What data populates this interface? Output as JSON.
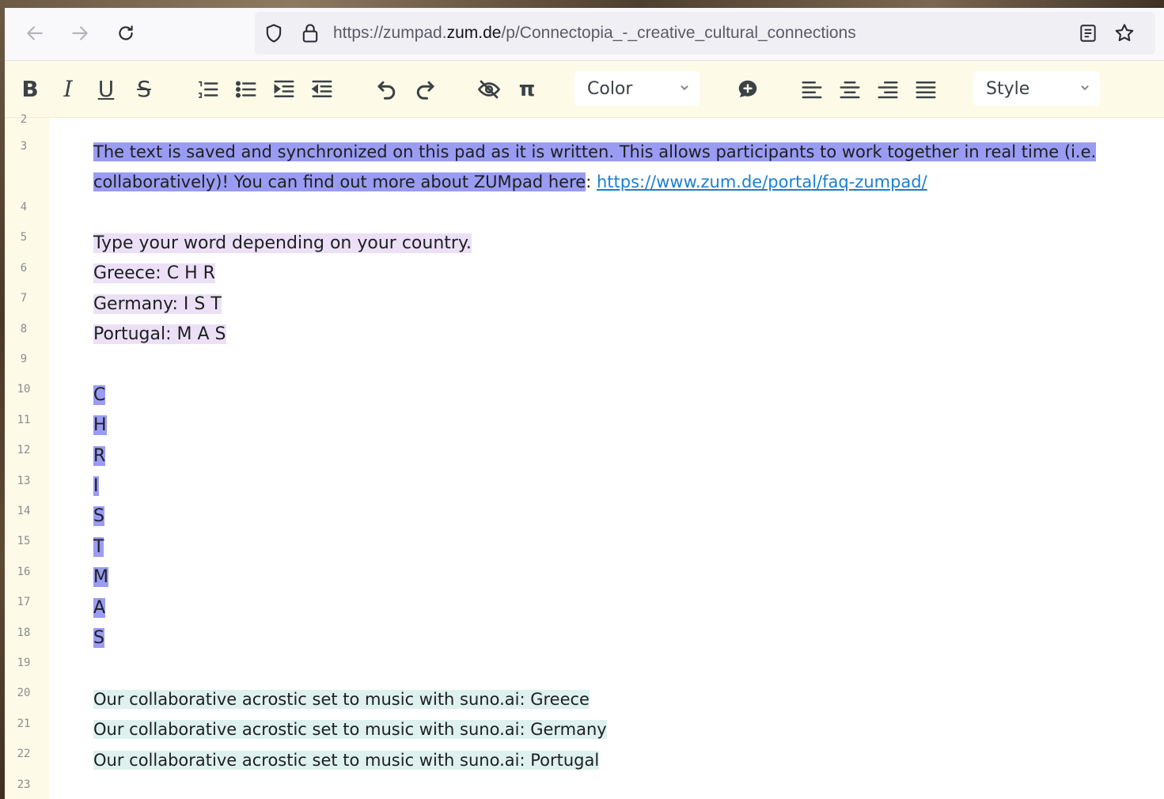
{
  "browser": {
    "url_prefix": "https://zumpad.",
    "url_domain": "zum.de",
    "url_path": "/p/Connectopia_-_creative_cultural_connections"
  },
  "toolbar": {
    "bold_label": "B",
    "italic_label": "I",
    "underline_label": "U",
    "strike_label": "S",
    "pi_label": "π",
    "color_label": "Color",
    "style_label": "Style"
  },
  "editor": {
    "line_numbers": [
      "2",
      "3",
      "4",
      "5",
      "6",
      "7",
      "8",
      "9",
      "10",
      "11",
      "12",
      "13",
      "14",
      "15",
      "16",
      "17",
      "18",
      "19",
      "20",
      "21",
      "22",
      "23"
    ],
    "intro_line1": "The text is saved and synchronized on this pad as it is written. This allows participants to work together in real time (i.e.",
    "intro_line2": "collaboratively)! You can find out more about ZUMpad here",
    "intro_colon": ": ",
    "intro_link": "https://www.zum.de/portal/faq-zumpad/",
    "instruction": "Type your word depending on your country.",
    "greece": "Greece: C H R",
    "germany": "Germany: I S T",
    "portugal": "Portugal:  M A S",
    "acrostic": [
      "C",
      "H",
      "R",
      "I",
      "S",
      "T",
      "M",
      "A",
      "S"
    ],
    "song_greece": "Our collaborative acrostic set to music with suno.ai: Greece",
    "song_germany": "Our collaborative acrostic set to music with suno.ai: Germany",
    "song_portugal": "Our collaborative acrostic set to music with suno.ai: Portugal"
  },
  "colors": {
    "author_blue": "#9a9cf3",
    "author_lilac": "#ece0f6",
    "author_mint": "#dff1ef",
    "toolbar_bg": "#fdfbe8",
    "link": "#1c7fd0"
  }
}
